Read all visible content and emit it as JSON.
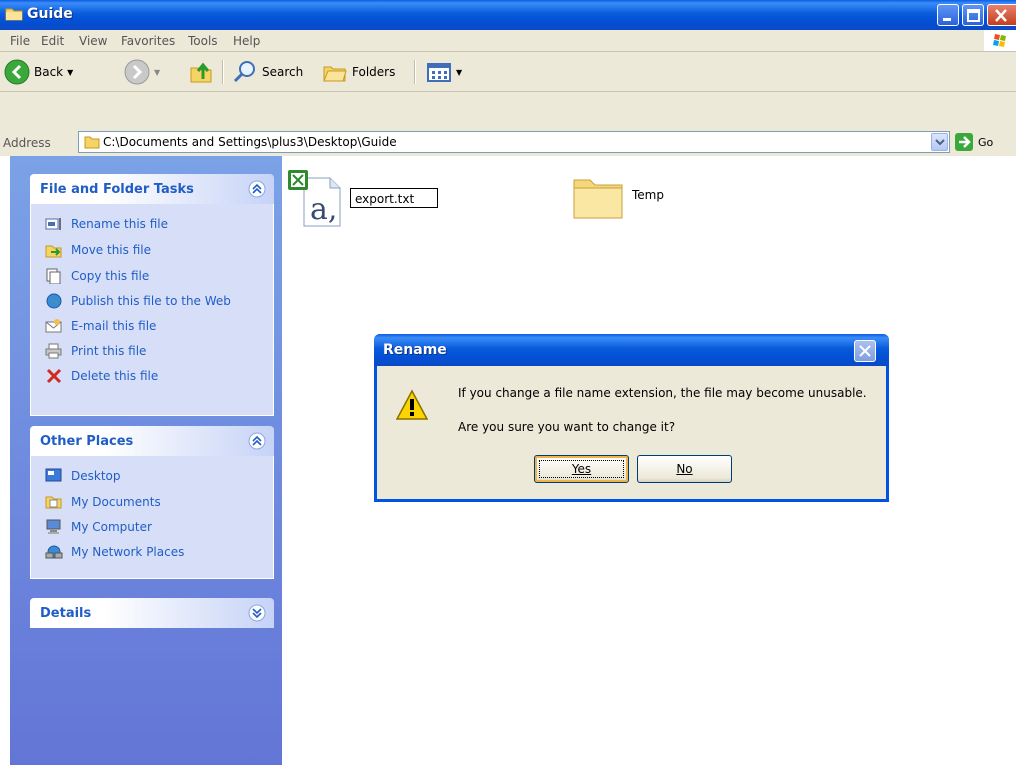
{
  "window": {
    "title": "Guide",
    "colors": {
      "titlebar": "#0a5bdc",
      "taskpane": "#6d8fe0",
      "link": "#215dc6"
    }
  },
  "menu": [
    "File",
    "Edit",
    "View",
    "Favorites",
    "Tools",
    "Help"
  ],
  "toolbar": {
    "back_label": "Back",
    "search_label": "Search",
    "folders_label": "Folders"
  },
  "address": {
    "label": "Address",
    "path": "C:\\Documents and Settings\\plus3\\Desktop\\Guide",
    "go_label": "Go"
  },
  "tasks_panel": {
    "title": "File and Folder Tasks",
    "items": [
      {
        "label": "Rename this file",
        "icon": "rename-icon"
      },
      {
        "label": "Move this file",
        "icon": "move-icon"
      },
      {
        "label": "Copy this file",
        "icon": "copy-icon"
      },
      {
        "label": "Publish this file to the Web",
        "icon": "globe-icon"
      },
      {
        "label": "E-mail this file",
        "icon": "email-icon"
      },
      {
        "label": "Print this file",
        "icon": "printer-icon"
      },
      {
        "label": "Delete this file",
        "icon": "delete-icon"
      }
    ]
  },
  "places_panel": {
    "title": "Other Places",
    "items": [
      {
        "label": "Desktop",
        "icon": "desktop-icon"
      },
      {
        "label": "My Documents",
        "icon": "my-documents-icon"
      },
      {
        "label": "My Computer",
        "icon": "my-computer-icon"
      },
      {
        "label": "My Network Places",
        "icon": "network-places-icon"
      }
    ]
  },
  "details_panel": {
    "title": "Details"
  },
  "files": [
    {
      "name": "export.txt",
      "type": "file",
      "editing": true
    },
    {
      "name": "Temp",
      "type": "folder"
    }
  ],
  "dialog": {
    "title": "Rename",
    "message1": "If you change a file name extension, the file may become unusable.",
    "message2": "Are you sure you want to change it?",
    "yes_label": "Yes",
    "no_label": "No"
  }
}
